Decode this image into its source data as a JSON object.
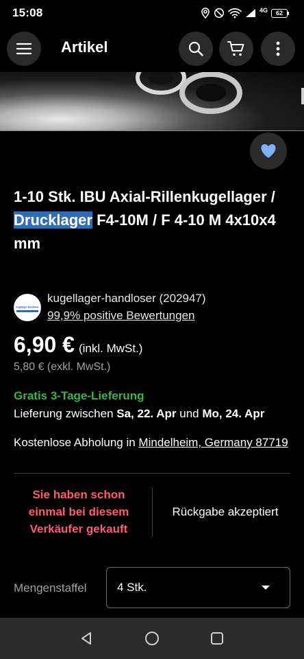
{
  "status_bar": {
    "time": "15:08",
    "network": "4G",
    "battery": "62"
  },
  "app_bar": {
    "title": "Artikel"
  },
  "product": {
    "title_part1": "1-10 Stk. IBU Axial-Rillenkugellager / ",
    "title_highlight": "Drucklager",
    "title_part2": " F4-10M / F 4-10 M 4x10x4 mm"
  },
  "seller": {
    "avatar_text": "Kugellager Handloser",
    "name": "kugellager-handloser (202947)",
    "rating": "99,9% positive Bewertungen"
  },
  "price": {
    "main": "6,90 €",
    "incl_note": "(inkl. MwSt.)",
    "excl": "5,80 € (exkl. MwSt.)"
  },
  "delivery": {
    "free": "Gratis 3-Tage-Lieferung",
    "range_prefix": "Lieferung zwischen ",
    "date_from": "Sa, 22. Apr",
    "range_mid": " und ",
    "date_to": "Mo, 24. Apr",
    "pickup_prefix": "Kostenlose Abholung in ",
    "pickup_location": "Mindelheim, Germany 87719"
  },
  "info": {
    "bought_before": "Sie haben schon einmal bei diesem Verkäufer gekauft",
    "returns": "Rückgabe akzeptiert"
  },
  "quantity": {
    "label": "Mengenstaffel",
    "selected": "4 Stk."
  },
  "colors": {
    "background": "#000000",
    "accent": "#2f6db4",
    "green": "#39b54a",
    "alert": "#ff5a6e",
    "favorite": "#7fb1f5"
  }
}
